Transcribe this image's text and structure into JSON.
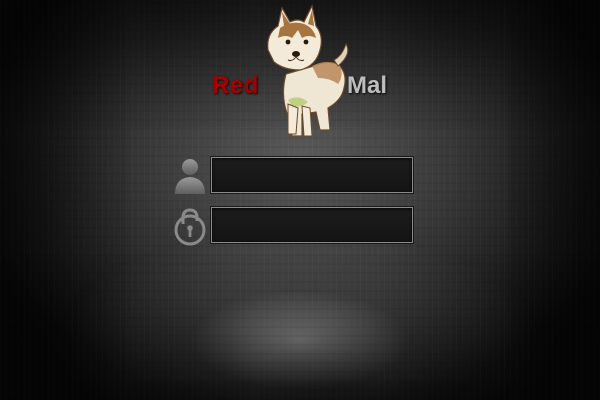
{
  "logo": {
    "brand_left": "Red",
    "brand_right": "Mal",
    "brand_left_color": "#a80000",
    "brand_right_color": "#bdbdbd",
    "mascot": "husky-puppy"
  },
  "login": {
    "username": {
      "icon": "user-icon",
      "value": "",
      "placeholder": ""
    },
    "password": {
      "icon": "padlock-icon",
      "value": "",
      "placeholder": ""
    }
  },
  "theme": {
    "background": "#2e2e2e",
    "field_background": "#181818",
    "field_border": "#8a8a8a"
  }
}
